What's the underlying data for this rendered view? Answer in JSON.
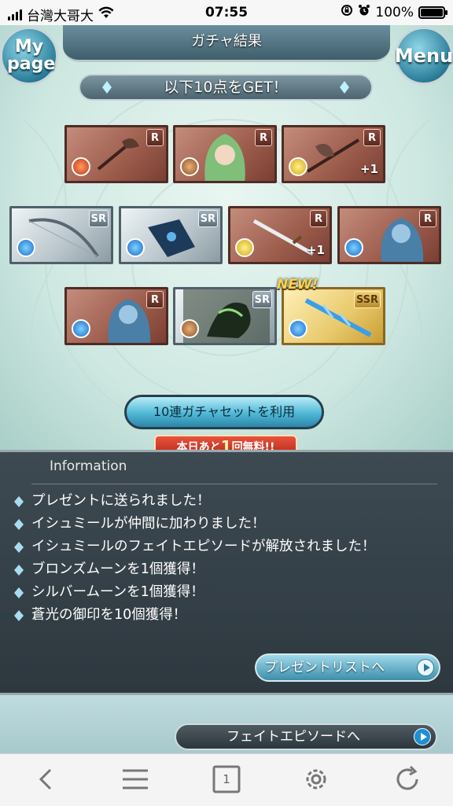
{
  "status_bar": {
    "carrier": "台灣大哥大",
    "time": "07:55",
    "battery": "100%"
  },
  "header": {
    "title": "ガチャ結果",
    "mypage": "My page",
    "menu": "Menu"
  },
  "get_banner": "以下10点をGET！",
  "cards": [
    {
      "rarity": "R",
      "element": "fire",
      "art": "weapon-axe",
      "plus": ""
    },
    {
      "rarity": "R",
      "element": "earth",
      "art": "character-green-hair",
      "plus": ""
    },
    {
      "rarity": "R",
      "element": "light",
      "art": "weapon-axe",
      "plus": "+1"
    },
    {
      "rarity": "SR",
      "element": "water",
      "art": "weapon-bow",
      "plus": ""
    },
    {
      "rarity": "SR",
      "element": "water",
      "art": "weapon-gauntlet",
      "plus": ""
    },
    {
      "rarity": "R",
      "element": "light",
      "art": "weapon-sword",
      "plus": "+1"
    },
    {
      "rarity": "R",
      "element": "water",
      "art": "armored-knight",
      "plus": ""
    },
    {
      "rarity": "R",
      "element": "water",
      "art": "armored-knight",
      "plus": ""
    },
    {
      "rarity": "SR",
      "element": "earth",
      "art": "dark-summon",
      "plus": ""
    },
    {
      "rarity": "SSR",
      "element": "water",
      "art": "weapon-blue-sword",
      "plus": ""
    }
  ],
  "new_badge": "NEW!",
  "gacha_button": "10連ガチャセットを利用",
  "free_note": {
    "prefix": "本日あと",
    "count": "1",
    "suffix": "回無料!!"
  },
  "info": {
    "title": "Information",
    "items": [
      "プレゼントに送られました！",
      "イシュミールが仲間に加わりました！",
      "イシュミールのフェイトエピソードが解放されました！",
      "ブロンズムーンを1個獲得！",
      "シルバームーンを1個獲得！",
      "蒼光の御印を10個獲得！"
    ],
    "present_button": "プレゼントリストへ"
  },
  "fate_button": "フェイトエピソードへ",
  "toolbar": {
    "tab_count": "1"
  }
}
